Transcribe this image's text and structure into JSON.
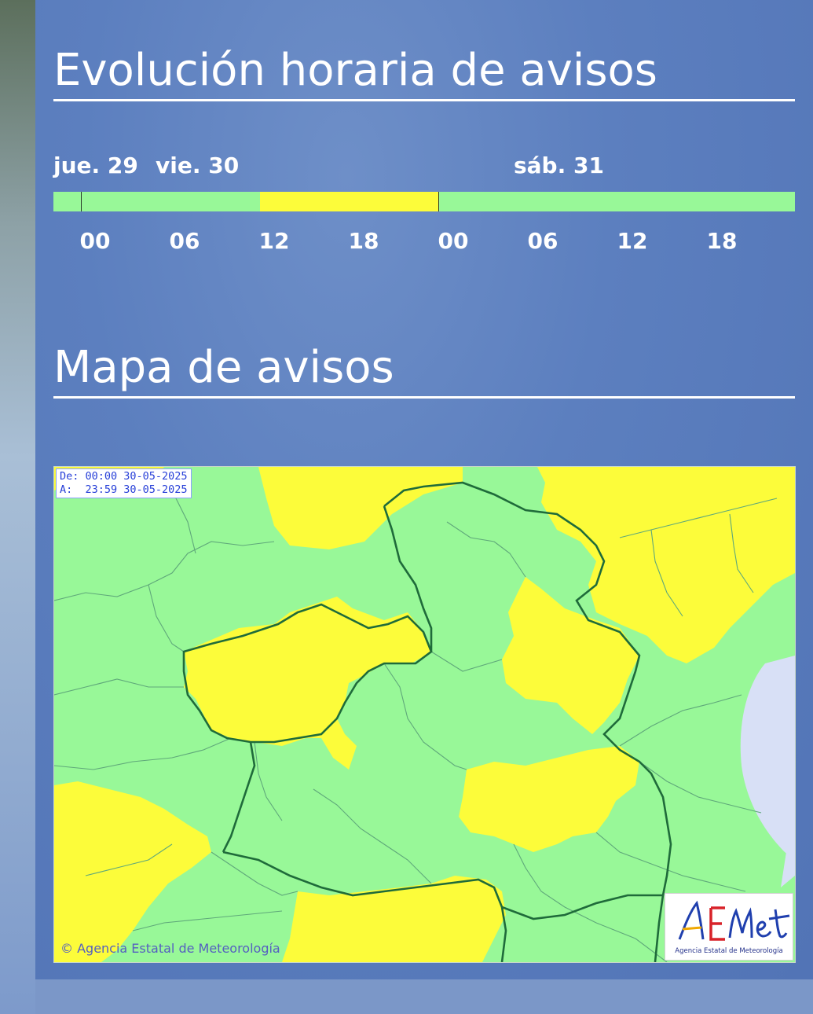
{
  "sections": {
    "evolution_title": "Evolución horaria de avisos",
    "map_title": "Mapa de avisos"
  },
  "timeline": {
    "days": [
      {
        "label": "jue. 29"
      },
      {
        "label": "vie. 30"
      },
      {
        "label": "sáb. 31"
      }
    ],
    "hours": [
      "00",
      "06",
      "12",
      "18",
      "00",
      "06",
      "12",
      "18"
    ],
    "levels": [
      {
        "from_hour": 0,
        "to_hour": 11,
        "level": "green"
      },
      {
        "from_hour": 11,
        "to_hour": 23,
        "level": "yellow"
      },
      {
        "from_hour": 23,
        "to_hour": 48,
        "level": "green"
      }
    ],
    "colors": {
      "green": "#98f898",
      "yellow": "#fcfc3a"
    }
  },
  "map": {
    "date_from": "De: 00:00 30-05-2025",
    "date_to": "A:  23:59 30-05-2025",
    "copyright": "© Agencia Estatal de Meteorología",
    "logo_text": "AEMet",
    "logo_subtitle": "Agencia Estatal de Meteorología",
    "colors": {
      "green": "#98f898",
      "yellow": "#fcfc3a",
      "sea": "#d8e0f6",
      "border": "#1f6b3a"
    }
  }
}
